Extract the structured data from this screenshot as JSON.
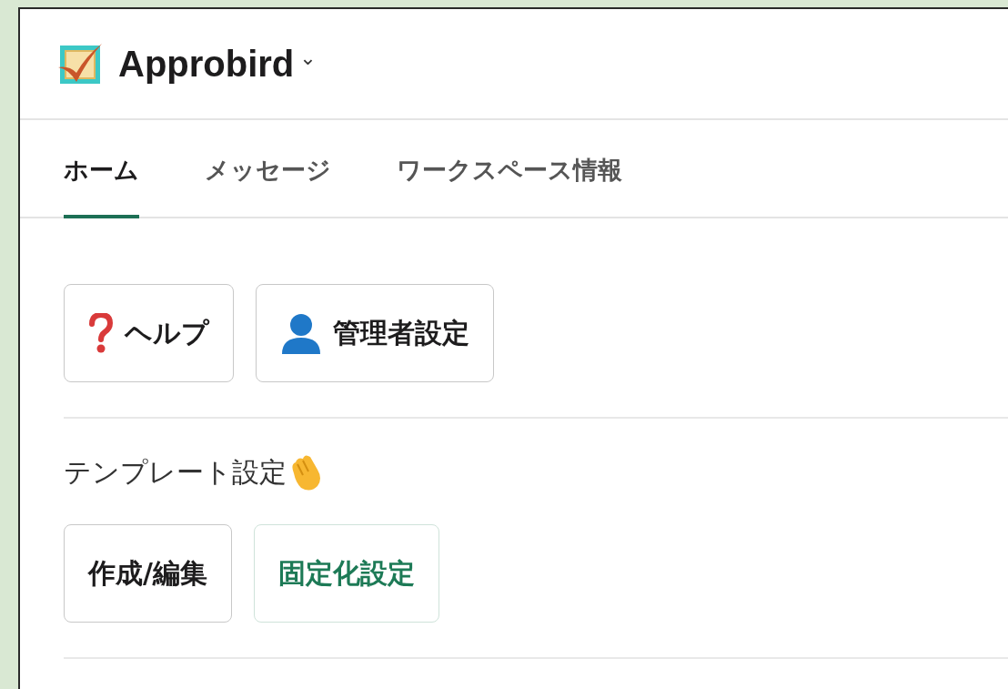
{
  "header": {
    "title": "Approbird",
    "caret": "⌄"
  },
  "tabs": [
    {
      "label": "ホーム",
      "selected": true
    },
    {
      "label": "メッセージ",
      "selected": false
    },
    {
      "label": "ワークスペース情報",
      "selected": false
    }
  ],
  "top_buttons": [
    {
      "label": "ヘルプ",
      "kind": "help"
    },
    {
      "label": "管理者設定",
      "kind": "admin"
    }
  ],
  "template_section": {
    "title": "テンプレート設定",
    "buttons": [
      {
        "label": "作成/編集",
        "kind": "default"
      },
      {
        "label": "固定化設定",
        "kind": "accent"
      }
    ]
  }
}
